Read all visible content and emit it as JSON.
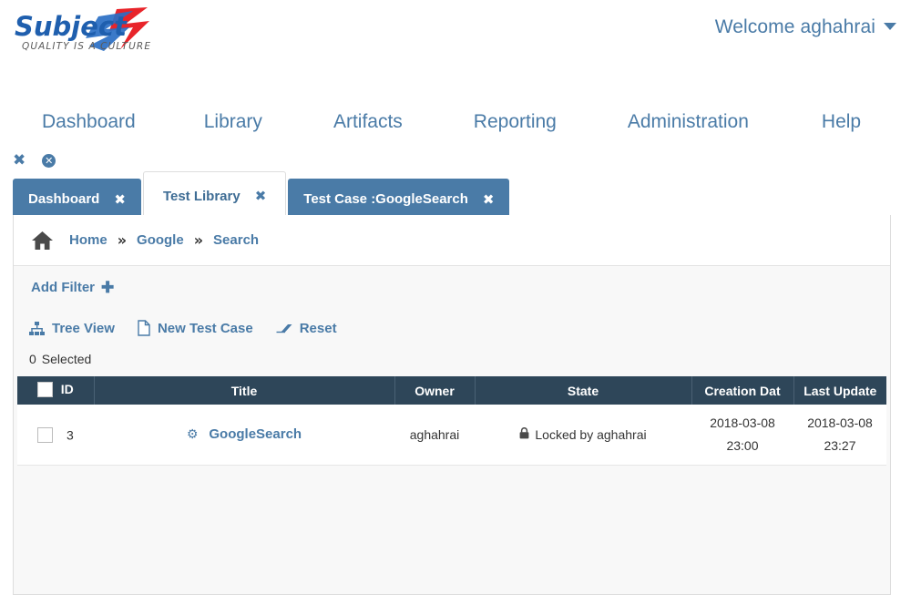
{
  "brand": {
    "name": "Subject7",
    "tagline": "QUALITY IS A CULTURE",
    "blue": "#1f5fae",
    "red": "#e8242a"
  },
  "header": {
    "welcome": "Welcome aghahrai",
    "caret_icon": "caret-down-icon"
  },
  "mainnav": {
    "items": [
      {
        "label": "Dashboard"
      },
      {
        "label": "Library"
      },
      {
        "label": "Artifacts"
      },
      {
        "label": "Reporting"
      },
      {
        "label": "Administration"
      },
      {
        "label": "Help"
      }
    ]
  },
  "tabstrip": {
    "tools": [
      {
        "name": "close-all-tabs-icon",
        "glyph": "✖"
      },
      {
        "name": "close-other-tabs-icon",
        "glyph": "✕"
      }
    ],
    "tabs": [
      {
        "label": "Dashboard",
        "active": false,
        "close_glyph": "✖"
      },
      {
        "label": "Test Library",
        "active": true,
        "close_glyph": "✖"
      },
      {
        "label": "Test Case :GoogleSearch",
        "active": false,
        "close_glyph": "✖"
      }
    ]
  },
  "breadcrumb": {
    "home_icon": "home-icon",
    "separator": "»",
    "items": [
      {
        "label": "Home"
      },
      {
        "label": "Google"
      },
      {
        "label": "Search"
      }
    ]
  },
  "filters": {
    "add_filter_label": "Add Filter",
    "add_filter_plus": "✚"
  },
  "actions": [
    {
      "label": "Tree View",
      "icon": "tree-view-icon"
    },
    {
      "label": "New Test Case",
      "icon": "new-document-icon"
    },
    {
      "label": "Reset",
      "icon": "eraser-icon"
    }
  ],
  "selection": {
    "count": "0",
    "label": "Selected"
  },
  "table": {
    "columns": [
      {
        "key": "id",
        "label": "ID"
      },
      {
        "key": "title",
        "label": "Title"
      },
      {
        "key": "owner",
        "label": "Owner"
      },
      {
        "key": "state",
        "label": "State"
      },
      {
        "key": "creation_date",
        "label": "Creation Dat"
      },
      {
        "key": "last_update",
        "label": "Last Update"
      }
    ],
    "header_checkbox_checked": false,
    "rows": [
      {
        "checked": false,
        "id": "3",
        "title": "GoogleSearch",
        "title_icon": "gear-icon",
        "owner": "aghahrai",
        "state": "Locked by aghahrai",
        "state_icon": "lock-icon",
        "creation_date": "2018-03-08",
        "creation_time": "23:00",
        "last_update_date": "2018-03-08",
        "last_update_time": "23:27"
      }
    ]
  }
}
